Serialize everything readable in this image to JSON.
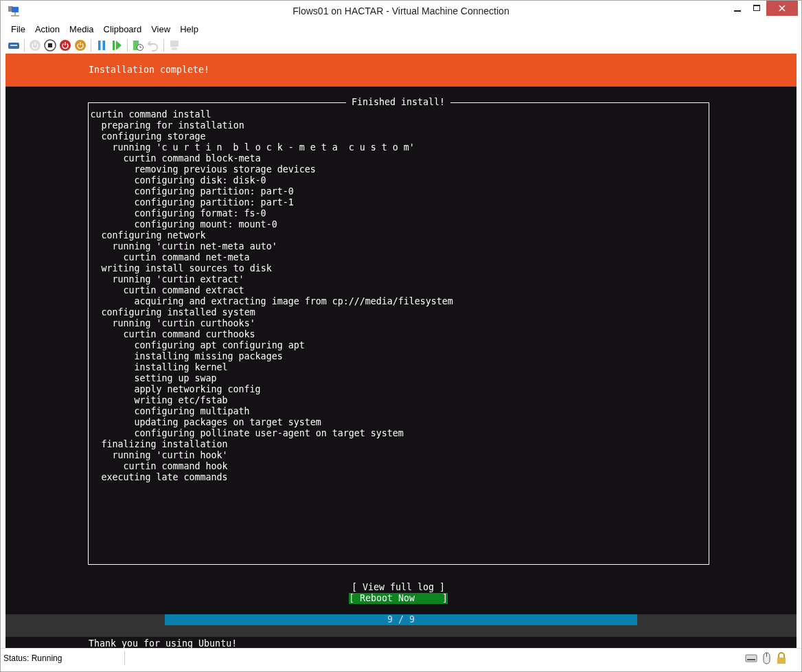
{
  "window": {
    "title": "Flows01 on HACTAR - Virtual Machine Connection"
  },
  "menu": [
    {
      "label": "File"
    },
    {
      "label": "Action"
    },
    {
      "label": "Media"
    },
    {
      "label": "Clipboard"
    },
    {
      "label": "View"
    },
    {
      "label": "Help"
    }
  ],
  "toolbar": [
    {
      "kind": "ctrlaltdel",
      "disabled": false
    },
    {
      "kind": "sep"
    },
    {
      "kind": "start",
      "disabled": true
    },
    {
      "kind": "stop",
      "disabled": false
    },
    {
      "kind": "shutdown",
      "disabled": false
    },
    {
      "kind": "save",
      "disabled": false
    },
    {
      "kind": "sep"
    },
    {
      "kind": "pause",
      "disabled": false
    },
    {
      "kind": "resume",
      "disabled": false
    },
    {
      "kind": "sep"
    },
    {
      "kind": "checkpoint",
      "disabled": false
    },
    {
      "kind": "revert",
      "disabled": true
    },
    {
      "kind": "sep"
    },
    {
      "kind": "session",
      "disabled": true
    }
  ],
  "installer": {
    "header": "Installation complete!",
    "frame_title": "Finished install!",
    "log": [
      {
        "text": "curtin command install",
        "children": [
          {
            "text": "preparing for installation"
          },
          {
            "text": "configuring storage",
            "children": [
              {
                "text": "running 'c u r t i n  b l o c k - m e t a  c u s t o m'",
                "children": [
                  {
                    "text": "curtin command block-meta",
                    "children": [
                      {
                        "text": "removing previous storage devices"
                      },
                      {
                        "text": "configuring disk: disk-0"
                      },
                      {
                        "text": "configuring partition: part-0"
                      },
                      {
                        "text": "configuring partition: part-1"
                      },
                      {
                        "text": "configuring format: fs-0"
                      },
                      {
                        "text": "configuring mount: mount-0"
                      }
                    ]
                  }
                ]
              }
            ]
          },
          {
            "text": "configuring network",
            "children": [
              {
                "text": "running 'curtin net-meta auto'",
                "children": [
                  {
                    "text": "curtin command net-meta"
                  }
                ]
              }
            ]
          },
          {
            "text": "writing install sources to disk",
            "children": [
              {
                "text": "running 'curtin extract'",
                "children": [
                  {
                    "text": "curtin command extract",
                    "children": [
                      {
                        "text": "acquiring and extracting image from cp:///media/filesystem"
                      }
                    ]
                  }
                ]
              }
            ]
          },
          {
            "text": "configuring installed system",
            "children": [
              {
                "text": "running 'curtin curthooks'",
                "children": [
                  {
                    "text": "curtin command curthooks",
                    "children": [
                      {
                        "text": "configuring apt configuring apt"
                      },
                      {
                        "text": "installing missing packages"
                      },
                      {
                        "text": "installing kernel"
                      },
                      {
                        "text": "setting up swap"
                      },
                      {
                        "text": "apply networking config"
                      },
                      {
                        "text": "writing etc/fstab"
                      },
                      {
                        "text": "configuring multipath"
                      },
                      {
                        "text": "updating packages on target system"
                      },
                      {
                        "text": "configuring pollinate user-agent on target system"
                      }
                    ]
                  }
                ]
              }
            ]
          },
          {
            "text": "finalizing installation",
            "children": [
              {
                "text": "running 'curtin hook'",
                "children": [
                  {
                    "text": "curtin command hook"
                  }
                ]
              }
            ]
          },
          {
            "text": "executing late commands"
          }
        ]
      }
    ],
    "buttons": [
      {
        "label": "[ View full log ]",
        "selected": false
      },
      {
        "label": "[ Reboot Now     ]",
        "selected": true
      }
    ],
    "progress": {
      "label": "9 / 9",
      "level": 1
    },
    "footer": "Thank you for using Ubuntu!"
  },
  "status_bar": {
    "status": "Status: Running"
  }
}
